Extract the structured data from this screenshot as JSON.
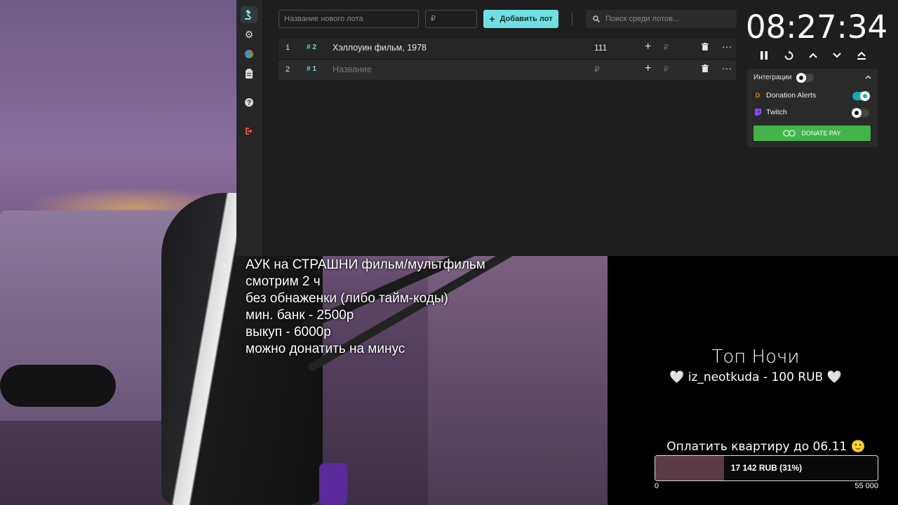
{
  "toolbar": {
    "lot_name_placeholder": "Название нового лота",
    "lot_amount_placeholder": "₽",
    "add_lot_label": "Добавить лот",
    "search_placeholder": "Поиск среди лотов..."
  },
  "lots": [
    {
      "index": "1",
      "id": "# 2",
      "name": "Хэллоуин фильм, 1978",
      "amount": "111",
      "add": "+",
      "extra": "₽"
    },
    {
      "index": "2",
      "id": "# 1",
      "name": "Название",
      "amount": "₽",
      "add": "+",
      "extra": "₽"
    }
  ],
  "timer": {
    "value": "08:27:34"
  },
  "integrations": {
    "title": "Интеграции",
    "items": [
      {
        "name": "Donation Alerts",
        "enabled": true,
        "color": "#f57d07"
      },
      {
        "name": "Twitch",
        "enabled": false,
        "color": "#9146ff"
      }
    ],
    "donatepay_label": "DONATE PAY"
  },
  "rules": {
    "lines": [
      "АУК на СТРАШНИ фильм/мультфильм",
      "смотрим 2 ч",
      "без обнаженки (либо тайм-коды)",
      "мин. банк - 2500р",
      "выкуп - 6000р",
      "можно донатить на минус"
    ]
  },
  "top_night": {
    "title": "Топ Ночи",
    "donor": "🤍 iz_neotkuda - 100 RUB 🤍"
  },
  "goal": {
    "title": "Оплатить квартиру до 06.11 🙂",
    "progress_text": "17 142 RUB (31%)",
    "progress_fraction": 0.31,
    "min": "0",
    "max": "55 000"
  },
  "colors": {
    "accent": "#6fe0e3",
    "donatepay": "#43b34b",
    "goal_fill": "#5a3a44"
  }
}
